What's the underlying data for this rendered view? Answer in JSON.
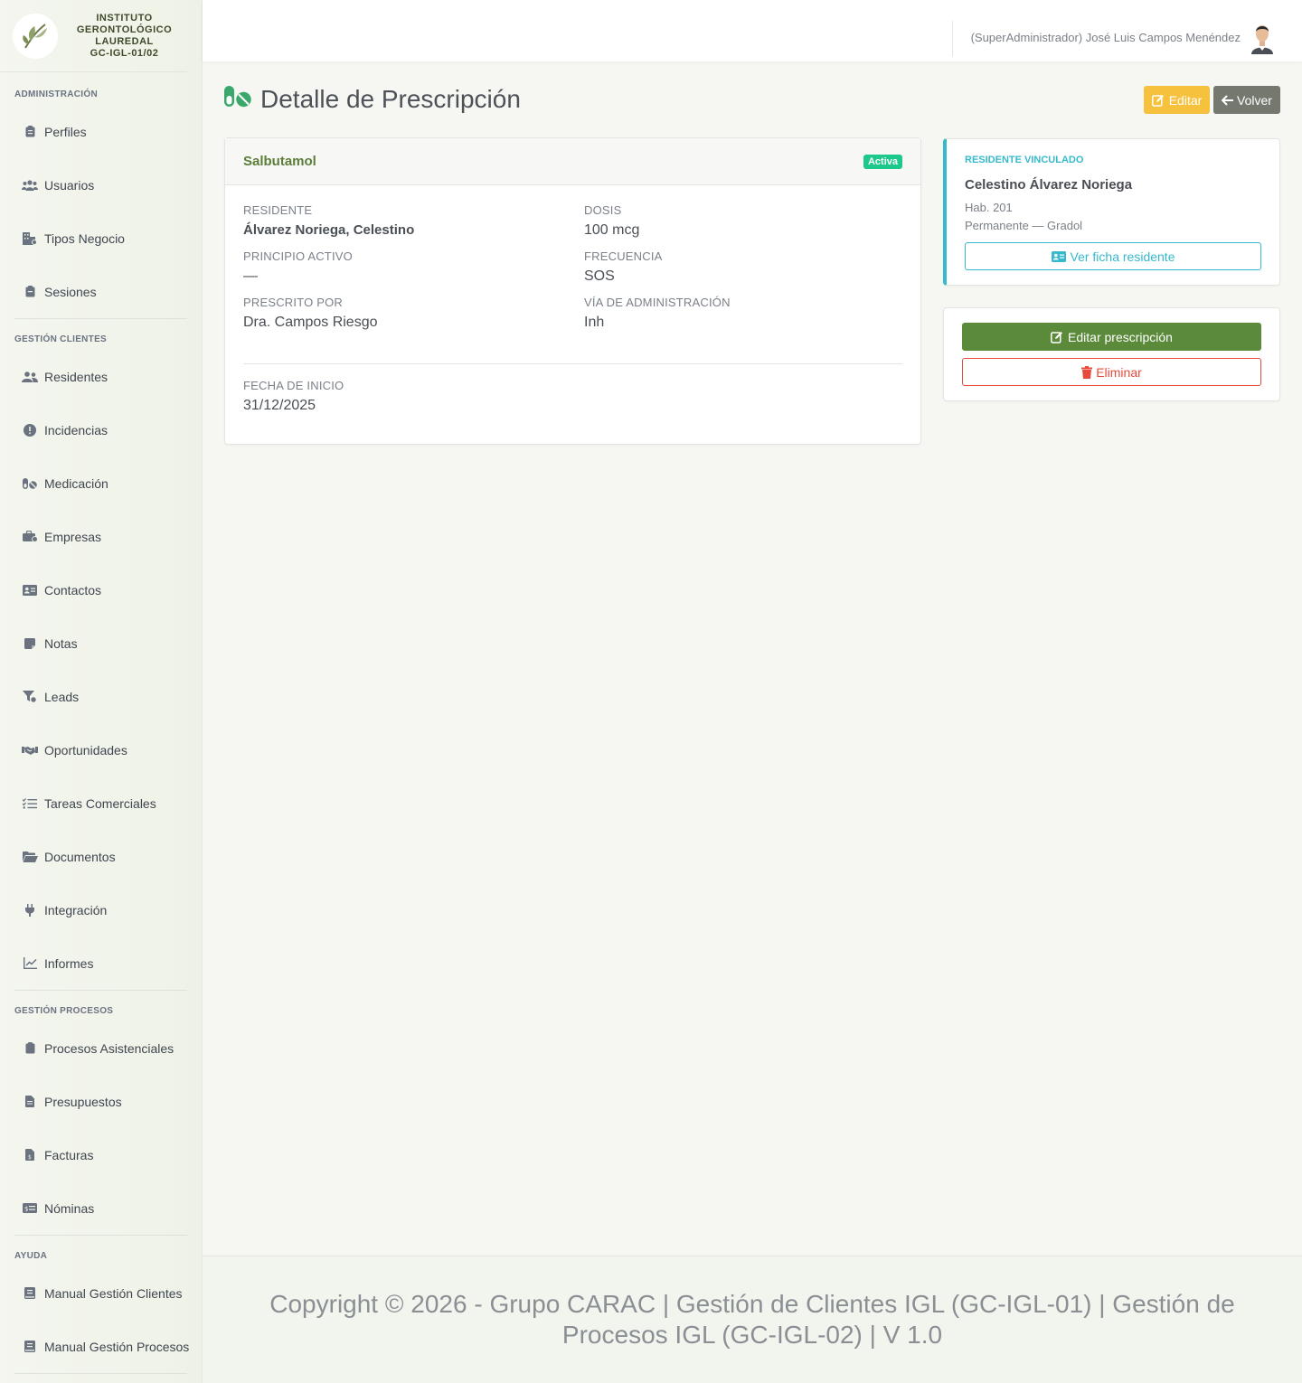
{
  "brand": {
    "line1": "INSTITUTO",
    "line2": "GERONTOLÓGICO",
    "line3": "LAUREDAL",
    "line4": "GC-IGL-01/02"
  },
  "sidebar": {
    "sections": [
      {
        "title": "ADMINISTRACIÓN",
        "items": [
          {
            "label": "Perfiles",
            "icon": "clipboard-icon"
          },
          {
            "label": "Usuarios",
            "icon": "users-icon"
          },
          {
            "label": "Tipos Negocio",
            "icon": "building-icon"
          },
          {
            "label": "Sesiones",
            "icon": "clipboard-icon"
          }
        ]
      },
      {
        "title": "GESTIÓN CLIENTES",
        "items": [
          {
            "label": "Residentes",
            "icon": "user-group-icon"
          },
          {
            "label": "Incidencias",
            "icon": "alert-icon"
          },
          {
            "label": "Medicación",
            "icon": "pills-icon"
          },
          {
            "label": "Empresas",
            "icon": "briefcase-icon"
          },
          {
            "label": "Contactos",
            "icon": "id-card-icon"
          },
          {
            "label": "Notas",
            "icon": "sticky-note-icon"
          },
          {
            "label": "Leads",
            "icon": "funnel-icon"
          },
          {
            "label": "Oportunidades",
            "icon": "handshake-icon"
          },
          {
            "label": "Tareas Comerciales",
            "icon": "tasks-icon"
          },
          {
            "label": "Documentos",
            "icon": "folder-icon"
          },
          {
            "label": "Integración",
            "icon": "plug-icon"
          },
          {
            "label": "Informes",
            "icon": "chart-line-icon"
          }
        ]
      },
      {
        "title": "GESTIÓN PROCESOS",
        "items": [
          {
            "label": "Procesos Asistenciales",
            "icon": "clipboard-icon"
          },
          {
            "label": "Presupuestos",
            "icon": "file-icon"
          },
          {
            "label": "Facturas",
            "icon": "invoice-icon"
          },
          {
            "label": "Nóminas",
            "icon": "money-icon"
          }
        ]
      },
      {
        "title": "AYUDA",
        "items": [
          {
            "label": "Manual Gestión Clientes",
            "icon": "book-icon"
          },
          {
            "label": "Manual Gestión Procesos",
            "icon": "book-icon"
          }
        ]
      }
    ]
  },
  "topbar": {
    "user": "(SuperAdministrador) José Luis Campos Menéndez"
  },
  "header": {
    "title": "Detalle de Prescripción",
    "edit_label": "Editar",
    "back_label": "Volver"
  },
  "prescription": {
    "drug": "Salbutamol",
    "status": "Activa",
    "fields": {
      "residente_label": "RESIDENTE",
      "residente": "Álvarez Noriega, Celestino",
      "dosis_label": "DOSIS",
      "dosis": "100 mcg",
      "principio_label": "PRINCIPIO ACTIVO",
      "principio": "—",
      "frecuencia_label": "FRECUENCIA",
      "frecuencia": "SOS",
      "prescrito_label": "PRESCRITO POR",
      "prescrito": "Dra. Campos Riesgo",
      "via_label": "VÍA DE ADMINISTRACIÓN",
      "via": "Inh",
      "fecha_label": "FECHA DE INICIO",
      "fecha": "31/12/2025"
    }
  },
  "linked_resident": {
    "label": "RESIDENTE VINCULADO",
    "name": "Celestino Álvarez Noriega",
    "room": "Hab. 201",
    "stay": "Permanente — Gradol",
    "button": "Ver ficha residente"
  },
  "actions": {
    "edit": "Editar prescripción",
    "delete": "Eliminar"
  },
  "footer": {
    "text": "Copyright © 2026 - Grupo CARAC | Gestión de Clientes IGL (GC-IGL-01) | Gestión de Procesos IGL (GC-IGL-02) | V 1.0"
  },
  "colors": {
    "primary_green": "#5a8a3a",
    "info": "#36b9cc",
    "warning": "#f6c23e",
    "danger": "#e74a3b",
    "success_badge": "#1cc88a"
  }
}
